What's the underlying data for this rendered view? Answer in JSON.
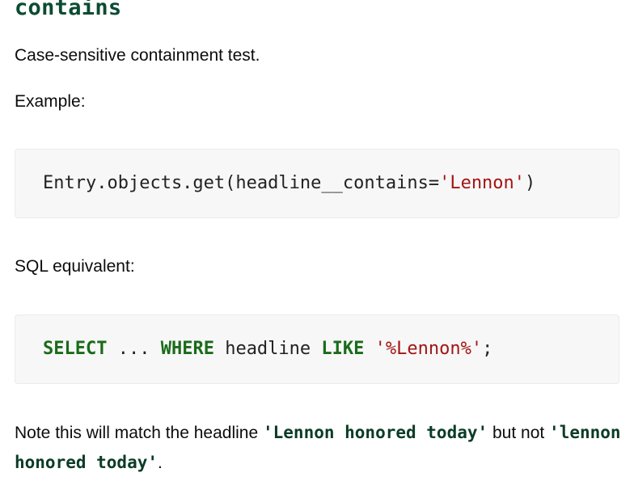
{
  "heading": "contains",
  "description": "Case-sensitive containment test.",
  "example_label": "Example:",
  "example_code": {
    "prefix": "Entry.objects.get(headline__contains=",
    "string": "'Lennon'",
    "suffix": ")"
  },
  "sql_label": "SQL equivalent:",
  "sql_code": {
    "select": "SELECT",
    "dots": " ... ",
    "where": "WHERE",
    "field": " headline ",
    "like": "LIKE",
    "space": " ",
    "pattern": "'%Lennon%'",
    "end": ";"
  },
  "note": {
    "before": "Note this will match the headline ",
    "match": "'Lennon honored today'",
    "middle": " but not ",
    "nomatch": "'lennon honored today'",
    "after": "."
  }
}
